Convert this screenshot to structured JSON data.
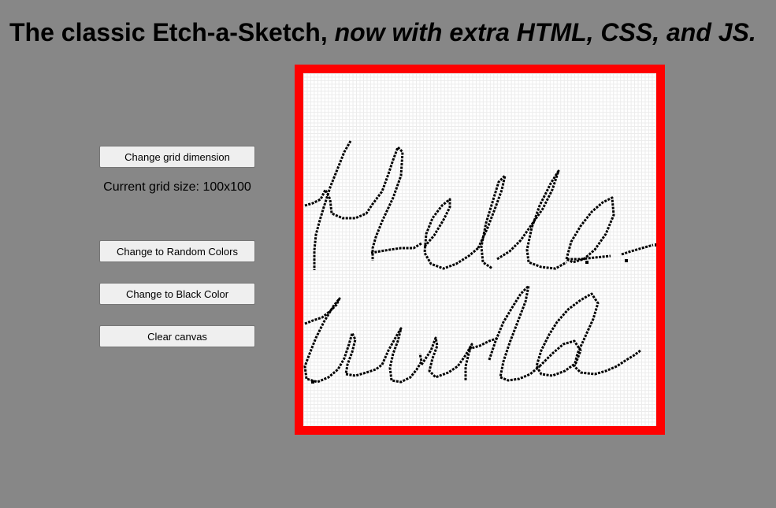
{
  "header": {
    "title_plain": "The classic Etch-a-Sketch, ",
    "title_italic": "now with extra HTML, CSS, and JS."
  },
  "controls": {
    "change_grid_label": "Change grid dimension",
    "grid_size_text": "Current grid size: 100x100",
    "random_colors_label": "Change to Random Colors",
    "black_color_label": "Change to Black Color",
    "clear_label": "Clear canvas"
  },
  "canvas": {
    "grid_columns": 100,
    "grid_rows": 100,
    "frame_color": "#ff0000",
    "ink_color": "#000000",
    "drawing_text": "Hello World"
  }
}
